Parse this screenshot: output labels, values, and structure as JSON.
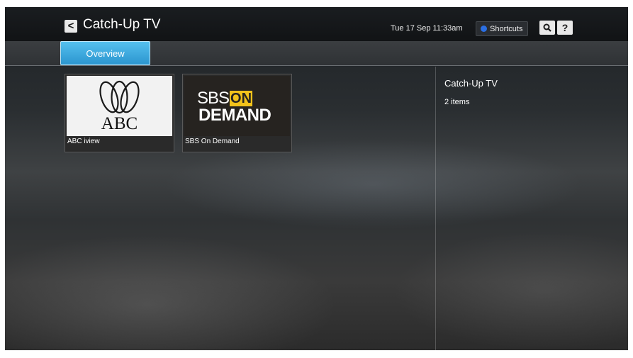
{
  "header": {
    "title": "Catch-Up TV",
    "datetime": "Tue 17 Sep 11:33am",
    "shortcuts_label": "Shortcuts",
    "back_icon_glyph": "<",
    "search_icon_glyph": "🔍",
    "help_icon_glyph": "?"
  },
  "tabs": [
    {
      "label": "Overview",
      "selected": true
    }
  ],
  "tiles": [
    {
      "label": "ABC iview",
      "logo_text": "ABC"
    },
    {
      "label": "SBS On Demand",
      "logo_line1": "SBS",
      "logo_on": "ON",
      "logo_line2": "DEMAND"
    }
  ],
  "info_panel": {
    "title": "Catch-Up TV",
    "count": "2 items"
  },
  "colors": {
    "accent": "#2b95cf",
    "shortcuts_dot": "#2b6fe3",
    "sbs_yellow": "#f2c21b"
  }
}
